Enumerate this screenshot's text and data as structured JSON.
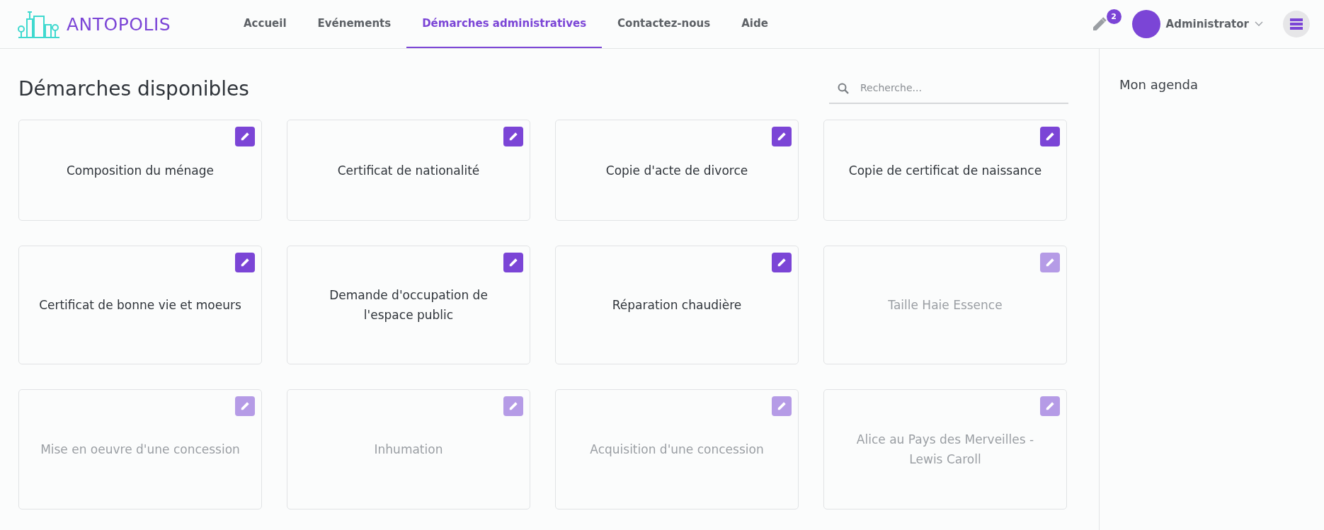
{
  "header": {
    "logo": "ANTOPOLIS",
    "nav": [
      {
        "label": "Accueil",
        "selected": false
      },
      {
        "label": "Evénements",
        "selected": false
      },
      {
        "label": "Démarches administratives",
        "selected": true
      },
      {
        "label": "Contactez-nous",
        "selected": false
      },
      {
        "label": "Aide",
        "selected": false
      }
    ],
    "edit_count": "2",
    "user": "Administrator"
  },
  "main": {
    "title": "Démarches disponibles",
    "search": {
      "placeholder": "Recherche..."
    },
    "rows": [
      [
        {
          "label": "Composition du ménage",
          "disabled": false
        },
        {
          "label": "Certificat de nationalité",
          "disabled": false
        },
        {
          "label": "Copie d'acte de divorce",
          "disabled": false
        },
        {
          "label": "Copie de certificat de naissance",
          "disabled": false
        }
      ],
      [
        {
          "label": "Certificat de bonne vie et moeurs",
          "disabled": false
        },
        {
          "label": "Demande d'occupation de l'espace public",
          "disabled": false
        },
        {
          "label": "Réparation chaudière",
          "disabled": false
        },
        {
          "label": "Taille Haie Essence",
          "disabled": true
        }
      ],
      [
        {
          "label": "Mise en oeuvre d'une concession",
          "disabled": true
        },
        {
          "label": "Inhumation",
          "disabled": true
        },
        {
          "label": "Acquisition d'une concession",
          "disabled": true
        },
        {
          "label": "Alice au Pays des Merveilles - Lewis Caroll",
          "disabled": true
        }
      ]
    ]
  },
  "sidebar": {
    "title": "Mon agenda"
  }
}
